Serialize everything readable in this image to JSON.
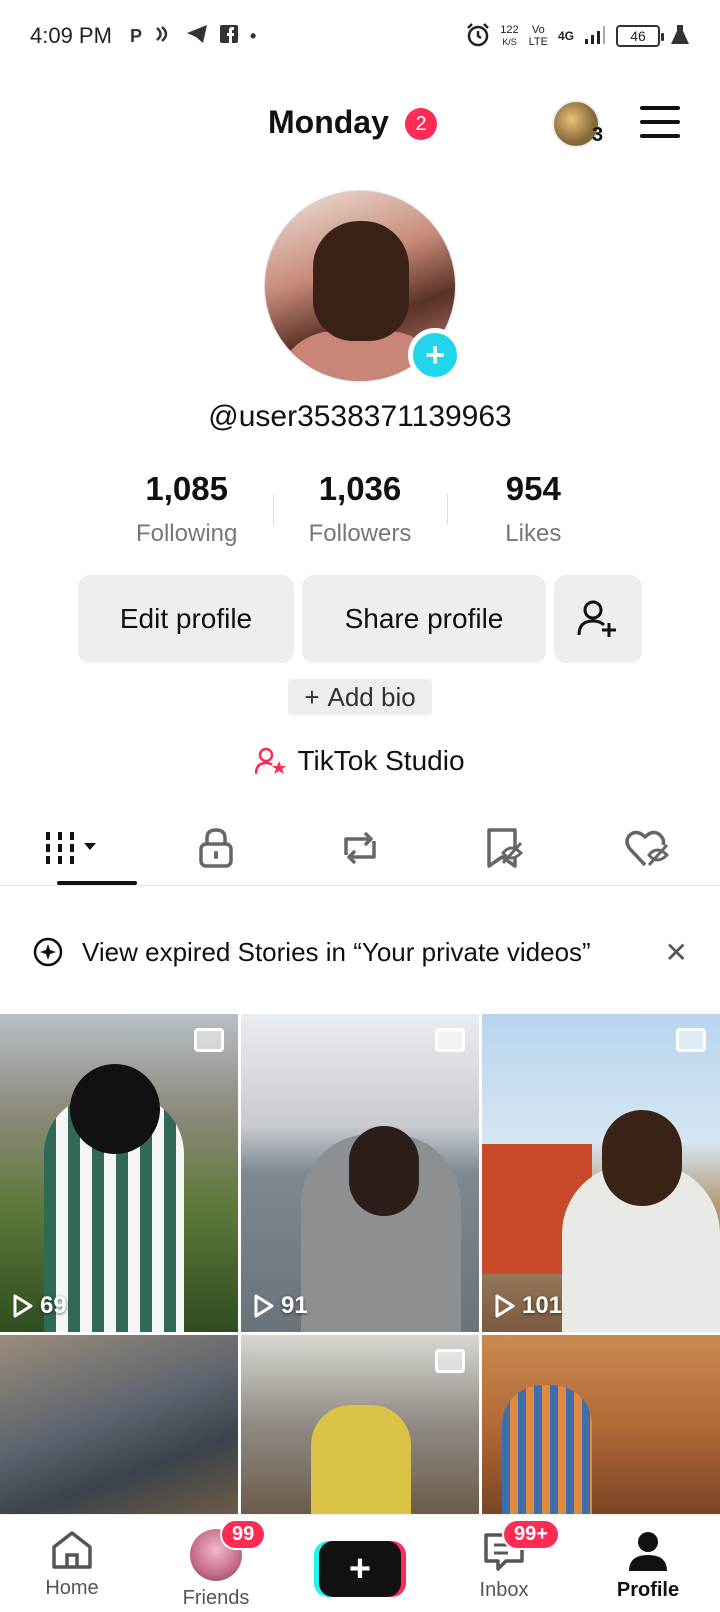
{
  "status_bar": {
    "time": "4:09 PM",
    "speed_value": "122",
    "speed_unit": "K/S",
    "network_top": "Vo",
    "network_bottom": "LTE",
    "network_gen": "4G",
    "battery": "46"
  },
  "header": {
    "title": "Monday",
    "title_badge": "2",
    "avatar_count": "3"
  },
  "profile": {
    "username": "@user3538371139963",
    "stats": [
      {
        "value": "1,085",
        "label": "Following"
      },
      {
        "value": "1,036",
        "label": "Followers"
      },
      {
        "value": "954",
        "label": "Likes"
      }
    ],
    "edit_label": "Edit profile",
    "share_label": "Share profile",
    "add_bio_label": "Add bio",
    "add_bio_plus": "+",
    "studio_label": "TikTok Studio"
  },
  "tabs": [
    "videos-tab",
    "private-tab",
    "reposts-tab",
    "favorites-tab",
    "liked-tab"
  ],
  "banner": {
    "text": "View expired Stories in “Your private videos”",
    "close": "✕"
  },
  "grid": [
    {
      "views": "69",
      "photo": true
    },
    {
      "views": "91",
      "photo": true
    },
    {
      "views": "101",
      "photo": true
    },
    {
      "views": "",
      "photo": false
    },
    {
      "views": "",
      "photo": true
    },
    {
      "views": "",
      "photo": false
    }
  ],
  "bottom_nav": {
    "home": "Home",
    "friends": "Friends",
    "friends_badge": "99",
    "plus": "+",
    "inbox": "Inbox",
    "inbox_badge": "99+",
    "profile": "Profile"
  },
  "colors": {
    "accent_red": "#fe2c55",
    "accent_cyan": "#20d5ec"
  }
}
